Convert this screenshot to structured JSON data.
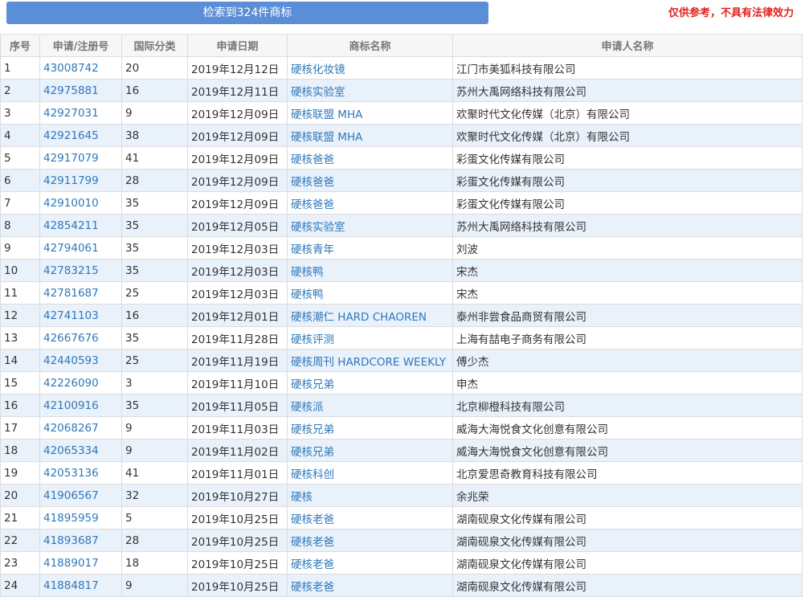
{
  "header": {
    "result_button": "检索到324件商标",
    "disclaimer": "仅供参考，不具有法律效力"
  },
  "table": {
    "columns": [
      "序号",
      "申请/注册号",
      "国际分类",
      "申请日期",
      "商标名称",
      "申请人名称"
    ],
    "rows": [
      [
        "1",
        "43008742",
        "20",
        "2019年12月12日",
        "硬核化妆镜",
        "江门市美狐科技有限公司"
      ],
      [
        "2",
        "42975881",
        "16",
        "2019年12月11日",
        "硬核实验室",
        "苏州大禹网络科技有限公司"
      ],
      [
        "3",
        "42927031",
        "9",
        "2019年12月09日",
        "硬核联盟 MHA",
        "欢聚时代文化传媒（北京）有限公司"
      ],
      [
        "4",
        "42921645",
        "38",
        "2019年12月09日",
        "硬核联盟 MHA",
        "欢聚时代文化传媒（北京）有限公司"
      ],
      [
        "5",
        "42917079",
        "41",
        "2019年12月09日",
        "硬核爸爸",
        "彩蛋文化传媒有限公司"
      ],
      [
        "6",
        "42911799",
        "28",
        "2019年12月09日",
        "硬核爸爸",
        "彩蛋文化传媒有限公司"
      ],
      [
        "7",
        "42910010",
        "35",
        "2019年12月09日",
        "硬核爸爸",
        "彩蛋文化传媒有限公司"
      ],
      [
        "8",
        "42854211",
        "35",
        "2019年12月05日",
        "硬核实验室",
        "苏州大禹网络科技有限公司"
      ],
      [
        "9",
        "42794061",
        "35",
        "2019年12月03日",
        "硬核青年",
        "刘波"
      ],
      [
        "10",
        "42783215",
        "35",
        "2019年12月03日",
        "硬核鸭",
        "宋杰"
      ],
      [
        "11",
        "42781687",
        "25",
        "2019年12月03日",
        "硬核鸭",
        "宋杰"
      ],
      [
        "12",
        "42741103",
        "16",
        "2019年12月01日",
        "硬核潮仁 HARD CHAOREN",
        "泰州非尝食品商贸有限公司"
      ],
      [
        "13",
        "42667676",
        "35",
        "2019年11月28日",
        "硬核评测",
        "上海有喆电子商务有限公司"
      ],
      [
        "14",
        "42440593",
        "25",
        "2019年11月19日",
        "硬核周刊 HARDCORE WEEKLY",
        "傅少杰"
      ],
      [
        "15",
        "42226090",
        "3",
        "2019年11月10日",
        "硬核兄弟",
        "申杰"
      ],
      [
        "16",
        "42100916",
        "35",
        "2019年11月05日",
        "硬核派",
        "北京柳橙科技有限公司"
      ],
      [
        "17",
        "42068267",
        "9",
        "2019年11月03日",
        "硬核兄弟",
        "威海大海悦食文化创意有限公司"
      ],
      [
        "18",
        "42065334",
        "9",
        "2019年11月02日",
        "硬核兄弟",
        "威海大海悦食文化创意有限公司"
      ],
      [
        "19",
        "42053136",
        "41",
        "2019年11月01日",
        "硬核科创",
        "北京爱思奇教育科技有限公司"
      ],
      [
        "20",
        "41906567",
        "32",
        "2019年10月27日",
        "硬核",
        "余兆荣"
      ],
      [
        "21",
        "41895959",
        "5",
        "2019年10月25日",
        "硬核老爸",
        "湖南砚泉文化传媒有限公司"
      ],
      [
        "22",
        "41893687",
        "28",
        "2019年10月25日",
        "硬核老爸",
        "湖南砚泉文化传媒有限公司"
      ],
      [
        "23",
        "41889017",
        "18",
        "2019年10月25日",
        "硬核老爸",
        "湖南砚泉文化传媒有限公司"
      ],
      [
        "24",
        "41884817",
        "9",
        "2019年10月25日",
        "硬核老爸",
        "湖南砚泉文化传媒有限公司"
      ]
    ]
  }
}
